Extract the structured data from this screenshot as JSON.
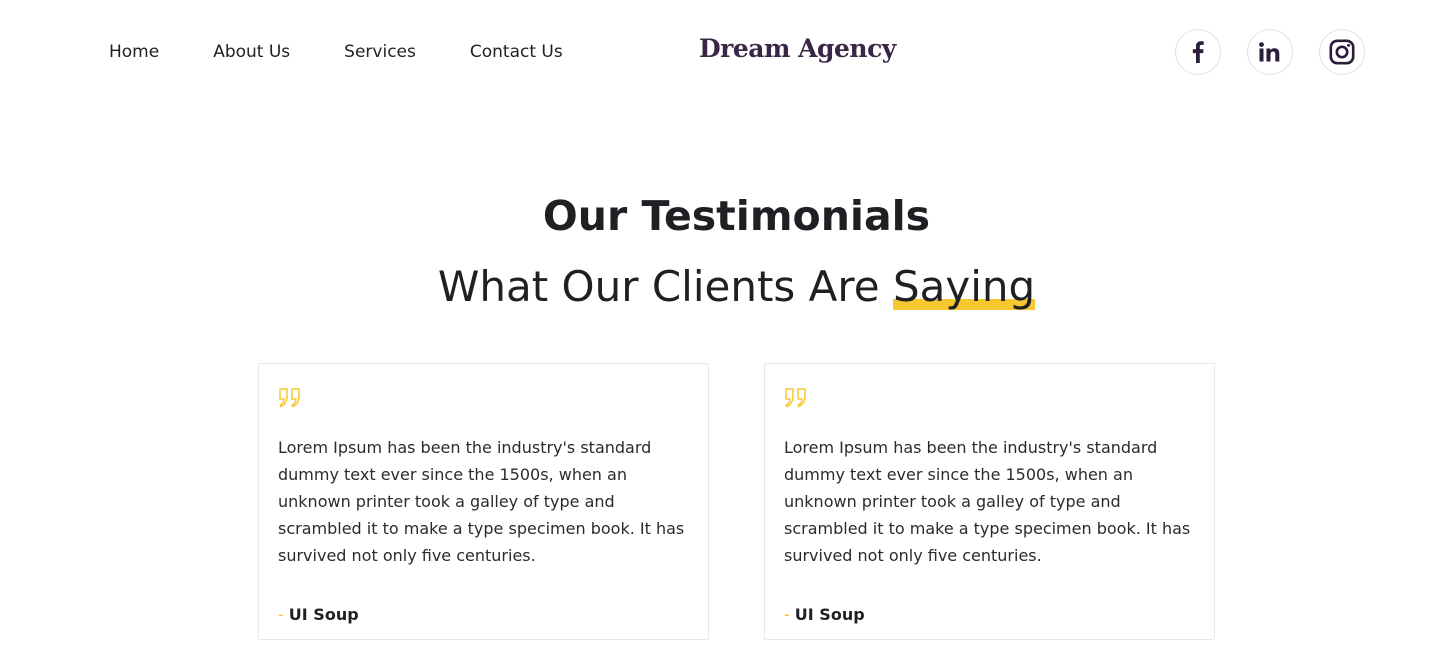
{
  "nav": {
    "items": [
      {
        "label": "Home"
      },
      {
        "label": "About Us"
      },
      {
        "label": "Services"
      },
      {
        "label": "Contact Us"
      }
    ]
  },
  "brand": {
    "name": "Dream Agency"
  },
  "socials": [
    {
      "icon": "facebook-icon"
    },
    {
      "icon": "linkedin-icon"
    },
    {
      "icon": "instagram-icon"
    }
  ],
  "section": {
    "title": "Our Testimonials",
    "subtitle_prefix": "What Our Clients Are ",
    "subtitle_highlight": "Saying"
  },
  "testimonials": [
    {
      "quote_icon": "quote-icon",
      "text": "Lorem Ipsum has been the industry's standard dummy text ever since the 1500s, when an unknown printer took a galley of type and scrambled it to make a type specimen book. It has survived not only five centuries.",
      "dash": "-",
      "author": "UI Soup"
    },
    {
      "quote_icon": "quote-icon",
      "text": "Lorem Ipsum has been the industry's standard dummy text ever since the 1500s, when an unknown printer took a galley of type and scrambled it to make a type specimen book. It has survived not only five centuries.",
      "dash": "-",
      "author": "UI Soup"
    }
  ],
  "colors": {
    "accent": "#f6c730",
    "brand": "#3a2646",
    "text": "#1f2024",
    "border": "#e8e8ea"
  }
}
